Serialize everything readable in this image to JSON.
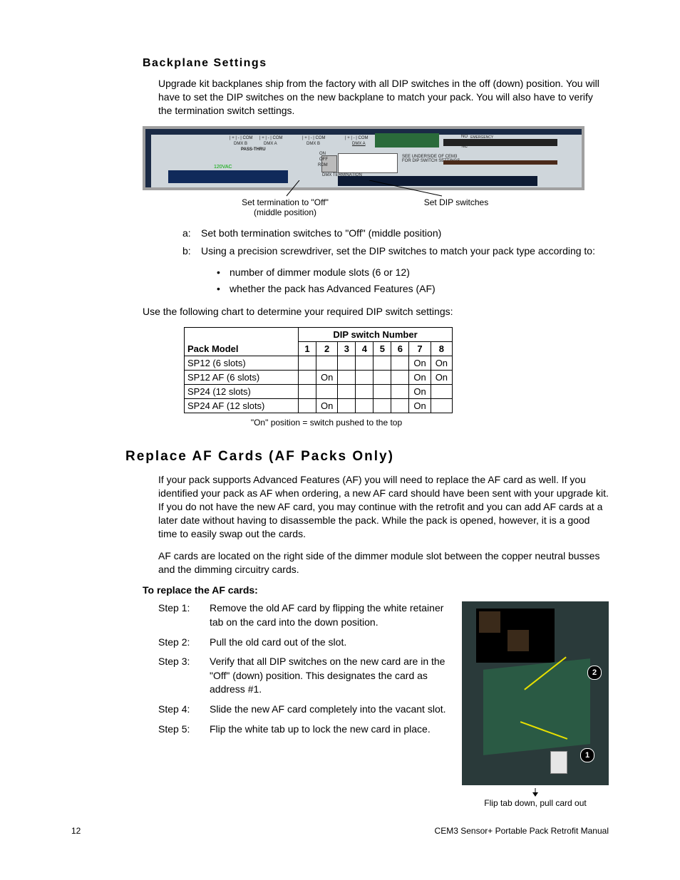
{
  "section1": {
    "heading": "Backplane Settings",
    "intro": "Upgrade kit backplanes ship from the factory with all DIP switches in the off (down) position. You will have to set the DIP switches on the new backplane to match your pack. You will also have to verify the termination switch settings.",
    "fig_labels_on_board": {
      "pass_thru": "PASS-THRU",
      "dmxb1": "DMX B",
      "dmxa1": "DMX A",
      "dmxb2": "DMX B",
      "dmxa2": "DMX A",
      "com1": "| + | - | COM",
      "com2": "| + | - | COM",
      "com3": "| + | - | COM",
      "com4": "| + | - | COM",
      "on": "ON",
      "off": "OFF",
      "rdm": "RDM",
      "term": "DMX TERMINATION",
      "underside": "SEE UNDERSIDE OF CEM3 FOR DIP SWITCH SETTINGS",
      "vac": "120VAC",
      "no": "NO",
      "nc": "NC",
      "emerg": "EMERGENCY CONTACT"
    },
    "leader_left_1": "Set termination to \"Off\"",
    "leader_left_2": "(middle position)",
    "leader_right": "Set DIP switches",
    "alpha": [
      {
        "marker": "a:",
        "text": "Set both termination switches to \"Off\" (middle position)"
      },
      {
        "marker": "b:",
        "text": "Using a precision screwdriver, set the DIP switches to match your pack type according to:"
      }
    ],
    "bullets": [
      "number of dimmer module slots (6 or 12)",
      "whether the pack has Advanced Features (AF)"
    ],
    "use_chart": "Use the following chart to determine your required DIP switch settings:",
    "table_caption": "\"On\" position = switch pushed to the top"
  },
  "chart_data": {
    "type": "table",
    "title": "DIP switch Number",
    "row_header": "Pack Model",
    "columns": [
      "1",
      "2",
      "3",
      "4",
      "5",
      "6",
      "7",
      "8"
    ],
    "rows": [
      {
        "model": "SP12 (6 slots)",
        "cells": [
          "",
          "",
          "",
          "",
          "",
          "",
          "On",
          "On"
        ]
      },
      {
        "model": "SP12 AF (6 slots)",
        "cells": [
          "",
          "On",
          "",
          "",
          "",
          "",
          "On",
          "On"
        ]
      },
      {
        "model": "SP24 (12 slots)",
        "cells": [
          "",
          "",
          "",
          "",
          "",
          "",
          "On",
          ""
        ]
      },
      {
        "model": "SP24 AF (12 slots)",
        "cells": [
          "",
          "On",
          "",
          "",
          "",
          "",
          "On",
          ""
        ]
      }
    ]
  },
  "section2": {
    "heading": "Replace AF Cards (AF Packs Only)",
    "p1": "If your pack supports Advanced Features (AF) you will need to replace the AF card as well. If you identified your pack as AF when ordering, a new AF card should have been sent with your upgrade kit. If you do not have the new AF card, you may continue with the retrofit and you can add AF cards at a later date without having to disassemble the pack. While the pack is opened, however, it is a good time to easily swap out the cards.",
    "p2": "AF cards are located on the right side of the dimmer module slot between the copper neutral busses and the dimming circuitry cards.",
    "sub": "To replace the AF cards:",
    "steps": [
      {
        "label": "Step 1:",
        "text": "Remove the old AF card by flipping the white retainer tab on the card into the down position."
      },
      {
        "label": "Step 2:",
        "text": "Pull the old card out of the slot."
      },
      {
        "label": "Step 3:",
        "text": "Verify that all DIP switches on the new card are in the \"Off\" (down) position. This designates the card as address #1."
      },
      {
        "label": "Step 4:",
        "text": "Slide the new AF card completely into the vacant slot."
      },
      {
        "label": "Step 5:",
        "text": "Flip the white tab up to lock the new card in place."
      }
    ],
    "badges": {
      "b1": "1",
      "b2": "2"
    },
    "fig_caption": "Flip tab down, pull card out"
  },
  "footer": {
    "page": "12",
    "title": "CEM3 Sensor+ Portable Pack Retrofit Manual"
  }
}
